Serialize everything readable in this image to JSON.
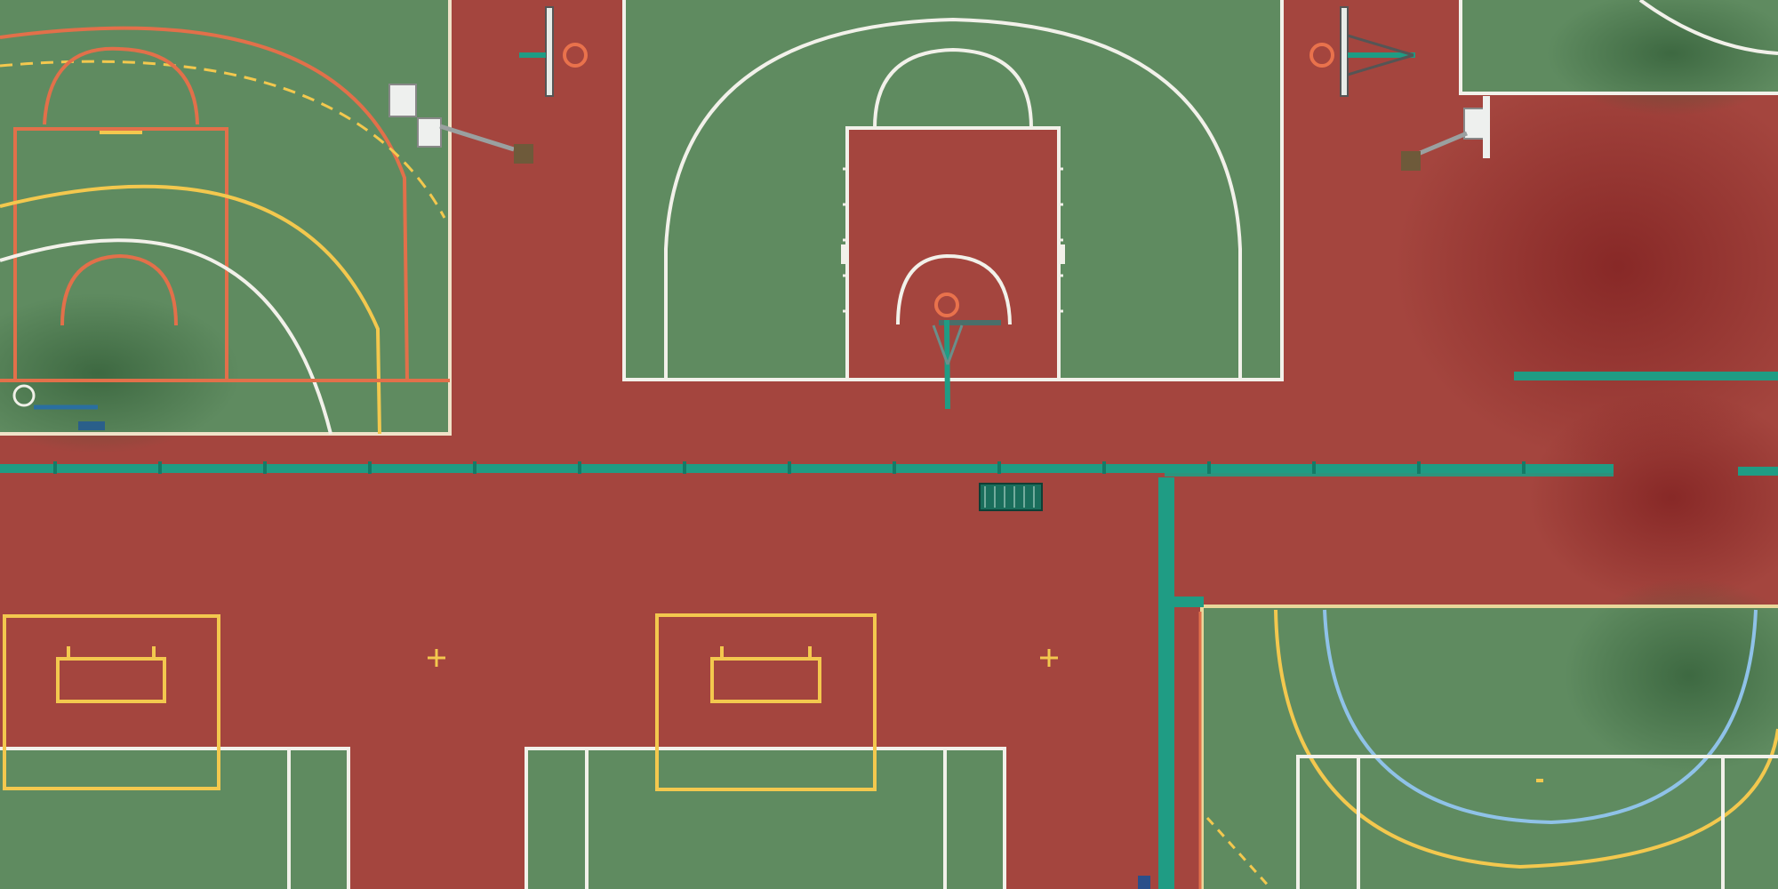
{
  "photo": {
    "subject": "basketball-courts-aerial-view"
  },
  "colors": {
    "red_surface": "#a4453e",
    "red_surface_dark": "#8e2f2b",
    "green_surface": "#5f8b60",
    "green_surface_dark": "#4f7a52",
    "white_line": "#f2f1ea",
    "yellow_line": "#f3c84e",
    "orange_line": "#e2704a",
    "blue_line": "#8fc2e8",
    "teal_fence": "#1f9c84",
    "hoop_orange": "#e9724c",
    "backboard": "#e8ece8"
  }
}
